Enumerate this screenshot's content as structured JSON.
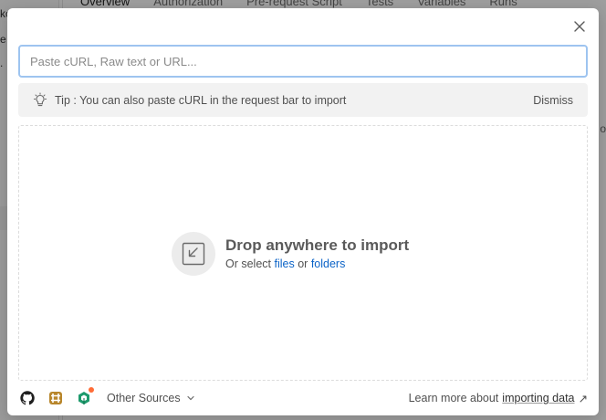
{
  "background": {
    "tabs": [
      "Overview",
      "Authorization",
      "Pre-request Script",
      "Tests",
      "Variables",
      "Runs"
    ],
    "sidebar_fragments": [
      "ko",
      "e",
      "."
    ],
    "right_fragment": "o"
  },
  "modal": {
    "input": {
      "placeholder": "Paste cURL, Raw text or URL...",
      "value": ""
    },
    "tip": {
      "text": "Tip : You can also paste cURL in the request bar to import",
      "dismiss_label": "Dismiss"
    },
    "drop_zone": {
      "title": "Drop anywhere to import",
      "prefix": "Or select",
      "files_link": "files",
      "connector": "or",
      "folders_link": "folders"
    },
    "footer": {
      "sources": [
        "github-icon",
        "swagger-hub-icon",
        "bitbucket-icon"
      ],
      "other_sources_label": "Other Sources",
      "learn_prefix": "Learn more about",
      "learn_link": "importing data",
      "learn_arrow": "↗"
    }
  },
  "colors": {
    "accent_link": "#0b63c7",
    "input_focus_border": "#9ec4f0",
    "notification_dot": "#ff6c37"
  }
}
